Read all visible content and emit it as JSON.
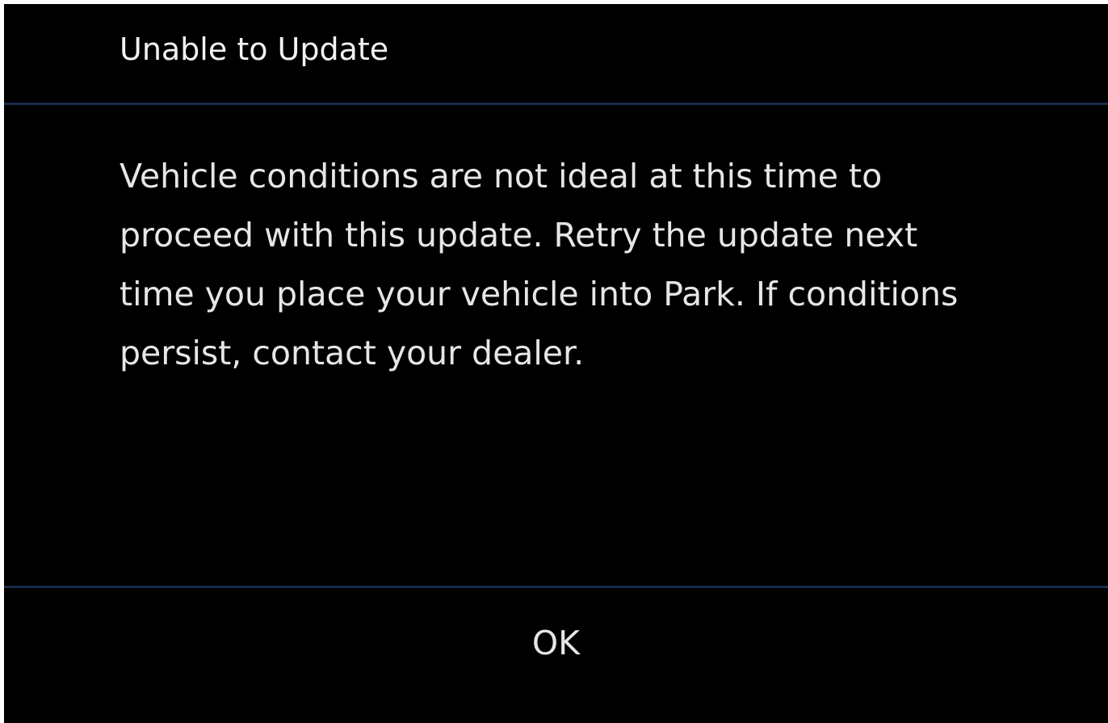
{
  "dialog": {
    "title": "Unable to Update",
    "message": "Vehicle conditions are not ideal at this time to proceed with this update. Retry the update next time you place your vehicle into Park. If conditions persist, contact your dealer.",
    "ok_label": "OK"
  },
  "colors": {
    "background": "#000000",
    "divider": "#1a2a4a",
    "text": "#e6e6e6"
  }
}
